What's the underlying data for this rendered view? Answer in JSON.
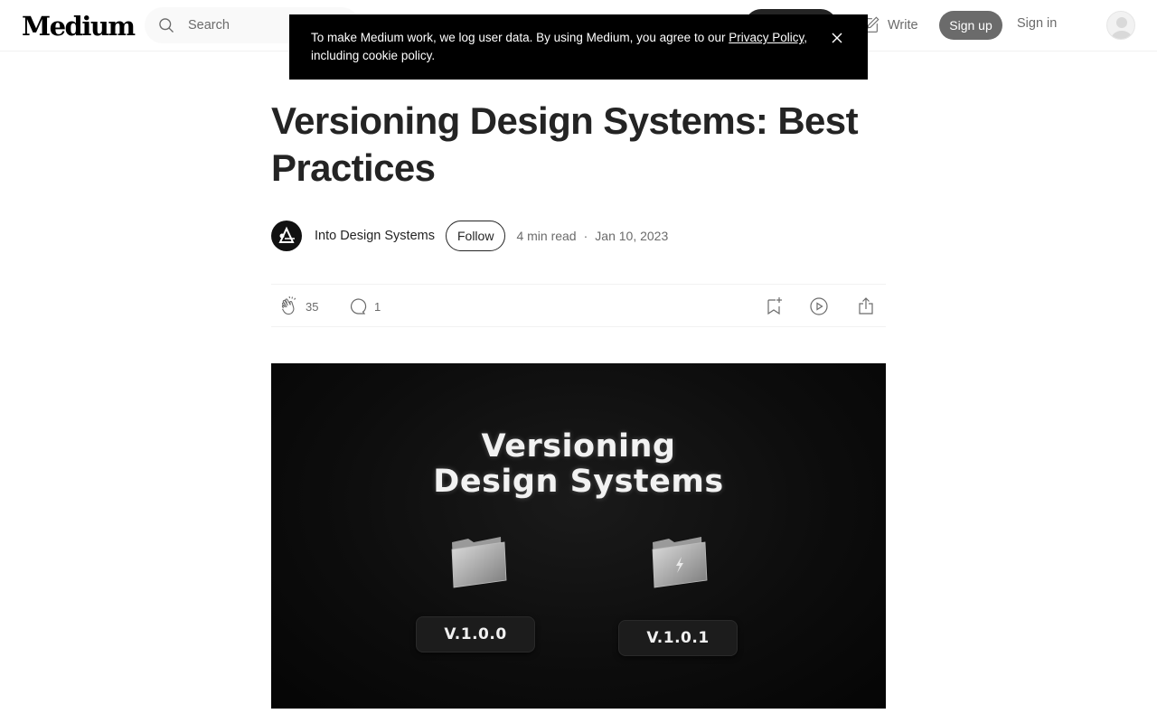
{
  "header": {
    "logo": "Medium",
    "search_placeholder": "Search",
    "write_label": "Write",
    "signup_label": "Sign up",
    "signin_label": "Sign in"
  },
  "cookie_banner": {
    "text_before": "To make Medium work, we log user data. By using Medium, you agree to our ",
    "link_text": "Privacy Policy",
    "text_after": ", including cookie policy."
  },
  "article": {
    "title": "Versioning Design Systems: Best Practices",
    "author": "Into Design Systems",
    "follow_label": "Follow",
    "read_time": "4 min read",
    "separator": "·",
    "date": "Jan 10, 2023",
    "claps": "35",
    "responses": "1"
  },
  "hero": {
    "title_line1": "Versioning",
    "title_line2": "Design Systems",
    "version_left": "V.1.0.0",
    "version_right": "V.1.0.1"
  },
  "colors": {
    "text": "#242424",
    "muted": "#6b6b6b",
    "banner_bg": "#000000",
    "signup_bg": "#6b6b6b"
  },
  "icons": [
    "search-icon",
    "write-icon",
    "close-icon",
    "clap-icon",
    "response-icon",
    "bookmark-add-icon",
    "play-icon",
    "share-icon",
    "folder-icon",
    "lightning-icon"
  ]
}
